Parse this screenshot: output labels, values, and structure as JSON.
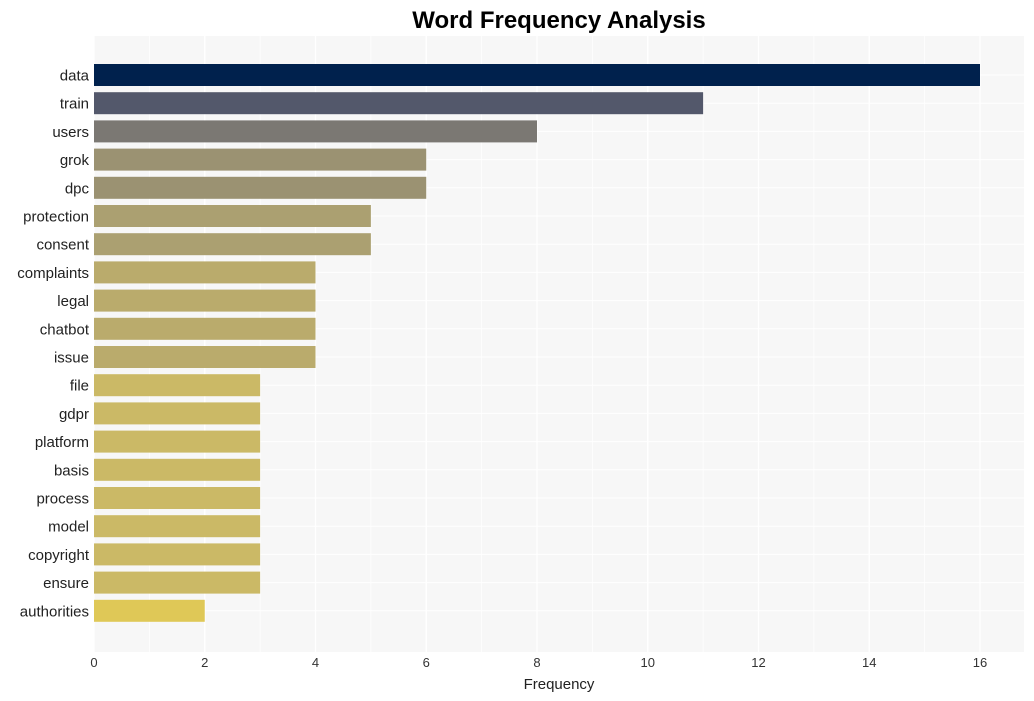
{
  "chart_data": {
    "type": "bar",
    "orientation": "horizontal",
    "title": "Word Frequency Analysis",
    "xlabel": "Frequency",
    "ylabel": "",
    "xlim": [
      0,
      16.8
    ],
    "xticks": [
      0,
      2,
      4,
      6,
      8,
      10,
      12,
      14,
      16
    ],
    "grid": true,
    "legend": "none",
    "background": "#f7f7f7",
    "categories": [
      "data",
      "train",
      "users",
      "grok",
      "dpc",
      "protection",
      "consent",
      "complaints",
      "legal",
      "chatbot",
      "issue",
      "file",
      "gdpr",
      "platform",
      "basis",
      "process",
      "model",
      "copyright",
      "ensure",
      "authorities"
    ],
    "values": [
      16,
      11,
      8,
      6,
      6,
      5,
      5,
      4,
      4,
      4,
      4,
      3,
      3,
      3,
      3,
      3,
      3,
      3,
      3,
      2
    ],
    "colors": [
      "#00214d",
      "#53586b",
      "#7b7873",
      "#9b9272",
      "#9b9272",
      "#aba071",
      "#aba071",
      "#baab6c",
      "#baab6c",
      "#baab6c",
      "#baab6c",
      "#cbb966",
      "#cbb966",
      "#cbb966",
      "#cbb966",
      "#cbb966",
      "#cbb966",
      "#cbb966",
      "#cbb966",
      "#dfc857"
    ]
  }
}
